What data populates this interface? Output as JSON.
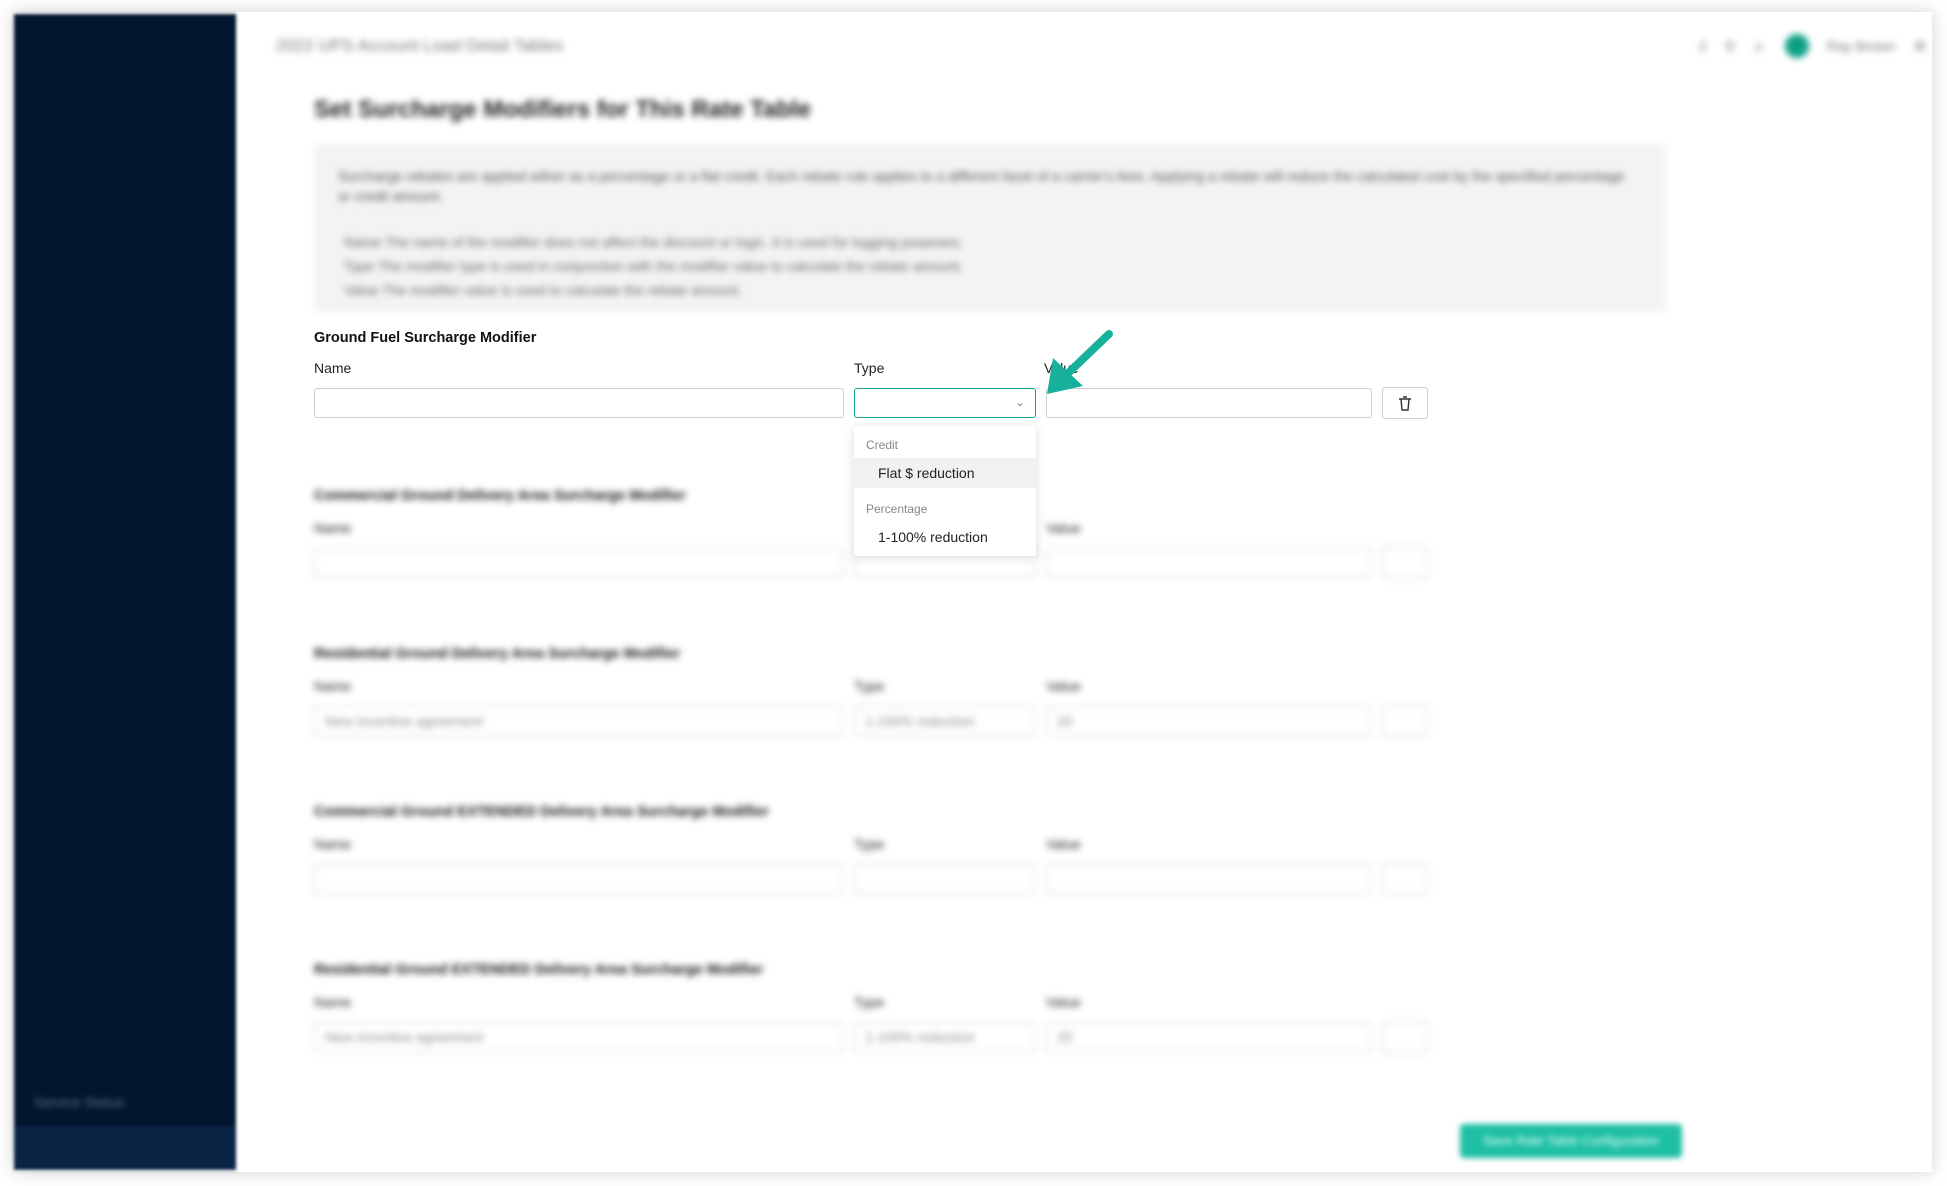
{
  "app": {
    "topbar_title": "2022 UPS Account Load Detail Tables",
    "user_name": "Ray Brown",
    "notif_count": "2",
    "sidebar_status": "Service Status"
  },
  "page": {
    "title": "Set Surcharge Modifiers for This Rate Table",
    "info": {
      "text": "Surcharge rebates are applied either as a percentage or a flat credit. Each rebate rule applies to a different facet of a carrier's fees. Applying a rebate will reduce the calculated cost by the specified percentage or credit amount.",
      "lines": [
        "Name  The name of the modifier does not affect the discount or logic. It is used for logging purposes.",
        "Type  The modifier type is used in conjunction with the modifier value to calculate the rebate amount.",
        "Value  The modifier value is used to calculate the rebate amount."
      ]
    }
  },
  "labels": {
    "name": "Name",
    "type": "Type",
    "value": "Value"
  },
  "sections": [
    {
      "title": "Ground Fuel Surcharge Modifier",
      "name_value": "",
      "type_value": "",
      "value_value": ""
    },
    {
      "title": "Commercial Ground Delivery Area Surcharge Modifier",
      "name_value": "",
      "type_value": "",
      "value_value": ""
    },
    {
      "title": "Residential Ground Delivery Area Surcharge Modifier",
      "name_value": "New incentive agreement",
      "type_value": "1-100% reduction",
      "value_value": "20"
    },
    {
      "title": "Commercial Ground EXTENDED Delivery Area Surcharge Modifier",
      "name_value": "",
      "type_value": "",
      "value_value": ""
    },
    {
      "title": "Residential Ground EXTENDED Delivery Area Surcharge Modifier",
      "name_value": "New incentive agreement",
      "type_value": "1-100% reduction",
      "value_value": "20"
    }
  ],
  "dropdown": {
    "groups": [
      {
        "label": "Credit",
        "option": "Flat $ reduction"
      },
      {
        "label": "Percentage",
        "option": "1-100% reduction"
      }
    ]
  },
  "submit_label": "Save Rate Table Configuration",
  "colors": {
    "sidebar": "#031630",
    "accent": "#12a58b",
    "arrow": "#17b09a",
    "submit": "#1ebfa4"
  }
}
